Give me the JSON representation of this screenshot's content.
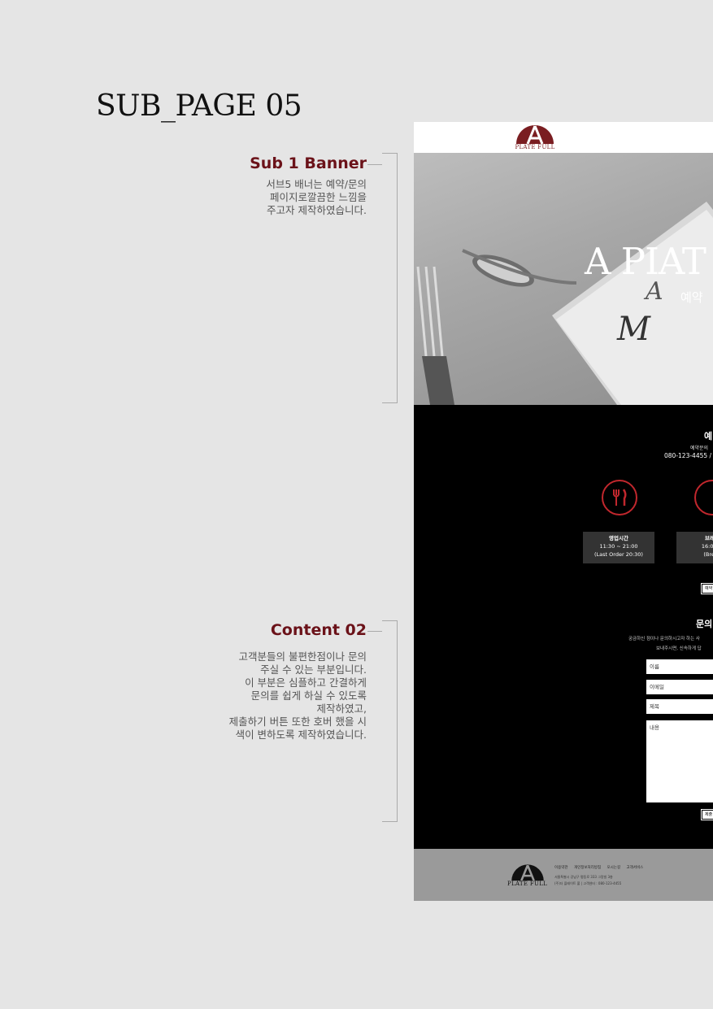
{
  "page_title": "SUB_PAGE 05",
  "notes": [
    {
      "heading": "Sub 1 Banner",
      "body": "서브5 배너는 예약/문의\n페이지로깔끔한 느낌을\n주고자 제작하였습니다."
    },
    {
      "heading": "Content 02",
      "body": "고객분들의 불편한점이나 문의\n주실 수 있는 부분입니다.\n이 부분은 심플하고 간결하게\n문의를 쉽게 하실 수 있도록\n제작하였고,\n제출하기 버튼 또한 호버 했을 시\n색이 변하도록 제작하였습니다."
    }
  ],
  "site": {
    "logo_text": "PLATE FULL",
    "banner": {
      "title": "A PIAT",
      "subtitle": "예약"
    },
    "reservation": {
      "heading": "예",
      "desc": "예약문의",
      "phone": "080-123-4455 /",
      "boxes": [
        {
          "title": "영업시간",
          "line1": "11:30 ~ 21:00",
          "line2": "(Last Order 20:30)"
        },
        {
          "title": "브레이",
          "line1": "16:00 ~",
          "line2": "(Break"
        }
      ],
      "button": "예약"
    },
    "inquiry": {
      "heading": "문의",
      "desc1": "궁금하신 점이나 문의하시고자 하는 사",
      "desc2": "보내주시면, 신속하게 답",
      "fields": [
        "이름",
        "이메일",
        "제목",
        "내용"
      ],
      "submit": "제출"
    },
    "footer": {
      "links": "이용약관 개인정보처리방침 오시는길 고객서비스",
      "info1": "서울특별시 강남구 평동로 333 그랑빌 3층",
      "info2": "(주)더 플레이트 풀 | 고객센터 : 080-123-4455"
    }
  },
  "colors": {
    "accent": "#6b1219",
    "icon_red": "#c1272d",
    "background": "#e5e5e5"
  },
  "icons": [
    "fork-knife-icon",
    "clock-icon",
    "plate-logo-icon"
  ]
}
